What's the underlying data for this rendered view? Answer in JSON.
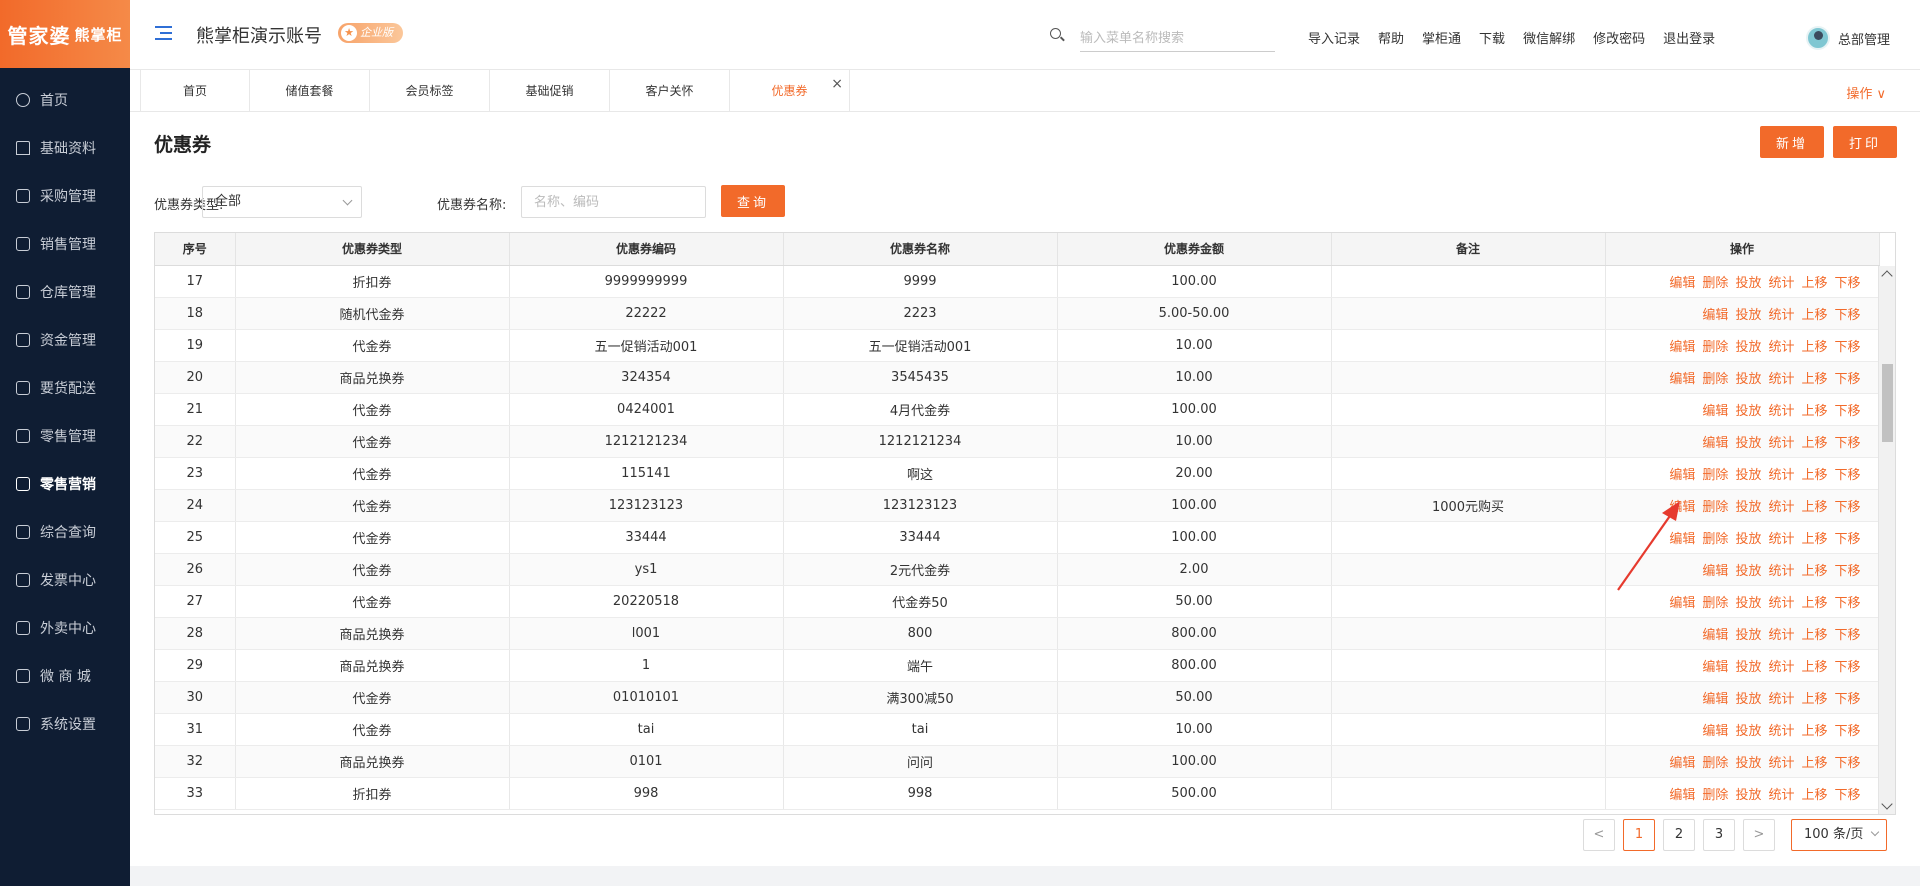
{
  "logo": {
    "text1": "管家婆",
    "text2": "熊掌柜"
  },
  "sidebar": {
    "items": [
      {
        "label": "首页",
        "icon": "globe-icon"
      },
      {
        "label": "基础资料",
        "icon": "home-icon"
      },
      {
        "label": "采购管理",
        "icon": "cart-icon"
      },
      {
        "label": "销售管理",
        "icon": "sales-icon"
      },
      {
        "label": "仓库管理",
        "icon": "warehouse-icon"
      },
      {
        "label": "资金管理",
        "icon": "money-icon"
      },
      {
        "label": "要货配送",
        "icon": "delivery-icon"
      },
      {
        "label": "零售管理",
        "icon": "retail-icon"
      },
      {
        "label": "零售营销",
        "icon": "gift-icon"
      },
      {
        "label": "综合查询",
        "icon": "chart-icon"
      },
      {
        "label": "发票中心",
        "icon": "invoice-icon"
      },
      {
        "label": "外卖中心",
        "icon": "takeout-icon"
      },
      {
        "label": "微 商 城",
        "icon": "shop-icon"
      },
      {
        "label": "系统设置",
        "icon": "gear-icon"
      }
    ],
    "active_index": 8
  },
  "header": {
    "account_title": "熊掌柜演示账号",
    "edition_badge": "企业版",
    "search_placeholder": "输入菜单名称搜索",
    "links": [
      "导入记录",
      "帮助",
      "掌柜通",
      "下载",
      "微信解绑",
      "修改密码",
      "退出登录"
    ],
    "user_name": "总部管理"
  },
  "tabs": {
    "items": [
      "首页",
      "储值套餐",
      "会员标签",
      "基础促销",
      "客户关怀",
      "优惠券"
    ],
    "active_index": 5,
    "close_glyph": "×",
    "ops_label": "操作 ∨"
  },
  "page": {
    "title": "优惠券",
    "add_button": "新增",
    "print_button": "打印",
    "filter_type_label": "优惠券类型:",
    "filter_type_value": "全部",
    "filter_name_label": "优惠券名称:",
    "filter_name_placeholder": "名称、编码",
    "query_button": "查询"
  },
  "table": {
    "columns": [
      "序号",
      "优惠券类型",
      "优惠券编码",
      "优惠券名称",
      "优惠券金额",
      "备注",
      "操作"
    ],
    "rows": [
      {
        "no": "17",
        "type": "折扣券",
        "code": "9999999999",
        "name": "9999",
        "amount": "100.00",
        "note": "",
        "actions": [
          "编辑",
          "删除",
          "投放",
          "统计",
          "上移",
          "下移"
        ]
      },
      {
        "no": "18",
        "type": "随机代金券",
        "code": "22222",
        "name": "2223",
        "amount": "5.00-50.00",
        "note": "",
        "actions": [
          "编辑",
          "投放",
          "统计",
          "上移",
          "下移"
        ]
      },
      {
        "no": "19",
        "type": "代金券",
        "code": "五一促销活动001",
        "name": "五一促销活动001",
        "amount": "10.00",
        "note": "",
        "actions": [
          "编辑",
          "删除",
          "投放",
          "统计",
          "上移",
          "下移"
        ]
      },
      {
        "no": "20",
        "type": "商品兑换券",
        "code": "324354",
        "name": "3545435",
        "amount": "10.00",
        "note": "",
        "actions": [
          "编辑",
          "删除",
          "投放",
          "统计",
          "上移",
          "下移"
        ]
      },
      {
        "no": "21",
        "type": "代金券",
        "code": "0424001",
        "name": "4月代金券",
        "amount": "100.00",
        "note": "",
        "actions": [
          "编辑",
          "投放",
          "统计",
          "上移",
          "下移"
        ]
      },
      {
        "no": "22",
        "type": "代金券",
        "code": "1212121234",
        "name": "1212121234",
        "amount": "10.00",
        "note": "",
        "actions": [
          "编辑",
          "投放",
          "统计",
          "上移",
          "下移"
        ]
      },
      {
        "no": "23",
        "type": "代金券",
        "code": "115141",
        "name": "啊这",
        "amount": "20.00",
        "note": "",
        "actions": [
          "编辑",
          "删除",
          "投放",
          "统计",
          "上移",
          "下移"
        ]
      },
      {
        "no": "24",
        "type": "代金券",
        "code": "123123123",
        "name": "123123123",
        "amount": "100.00",
        "note": "1000元购买",
        "actions": [
          "编辑",
          "删除",
          "投放",
          "统计",
          "上移",
          "下移"
        ]
      },
      {
        "no": "25",
        "type": "代金券",
        "code": "33444",
        "name": "33444",
        "amount": "100.00",
        "note": "",
        "actions": [
          "编辑",
          "删除",
          "投放",
          "统计",
          "上移",
          "下移"
        ]
      },
      {
        "no": "26",
        "type": "代金券",
        "code": "ys1",
        "name": "2元代金券",
        "amount": "2.00",
        "note": "",
        "actions": [
          "编辑",
          "投放",
          "统计",
          "上移",
          "下移"
        ]
      },
      {
        "no": "27",
        "type": "代金券",
        "code": "20220518",
        "name": "代金券50",
        "amount": "50.00",
        "note": "",
        "actions": [
          "编辑",
          "删除",
          "投放",
          "统计",
          "上移",
          "下移"
        ]
      },
      {
        "no": "28",
        "type": "商品兑换券",
        "code": "l001",
        "name": "800",
        "amount": "800.00",
        "note": "",
        "actions": [
          "编辑",
          "投放",
          "统计",
          "上移",
          "下移"
        ]
      },
      {
        "no": "29",
        "type": "商品兑换券",
        "code": "1",
        "name": "端午",
        "amount": "800.00",
        "note": "",
        "actions": [
          "编辑",
          "投放",
          "统计",
          "上移",
          "下移"
        ]
      },
      {
        "no": "30",
        "type": "代金券",
        "code": "01010101",
        "name": "满300减50",
        "amount": "50.00",
        "note": "",
        "actions": [
          "编辑",
          "投放",
          "统计",
          "上移",
          "下移"
        ]
      },
      {
        "no": "31",
        "type": "代金券",
        "code": "tai",
        "name": "tai",
        "amount": "10.00",
        "note": "",
        "actions": [
          "编辑",
          "投放",
          "统计",
          "上移",
          "下移"
        ]
      },
      {
        "no": "32",
        "type": "商品兑换券",
        "code": "0101",
        "name": "问问",
        "amount": "100.00",
        "note": "",
        "actions": [
          "编辑",
          "删除",
          "投放",
          "统计",
          "上移",
          "下移"
        ]
      },
      {
        "no": "33",
        "type": "折扣券",
        "code": "998",
        "name": "998",
        "amount": "500.00",
        "note": "",
        "actions": [
          "编辑",
          "删除",
          "投放",
          "统计",
          "上移",
          "下移"
        ]
      }
    ]
  },
  "pagination": {
    "prev": "<",
    "pages": [
      "1",
      "2",
      "3"
    ],
    "active_page": "1",
    "next": ">",
    "page_size": "100 条/页"
  },
  "colors": {
    "accent": "#f26a2a",
    "sidebar_bg": "#0f1d33",
    "annotation": "#e63a2e"
  }
}
